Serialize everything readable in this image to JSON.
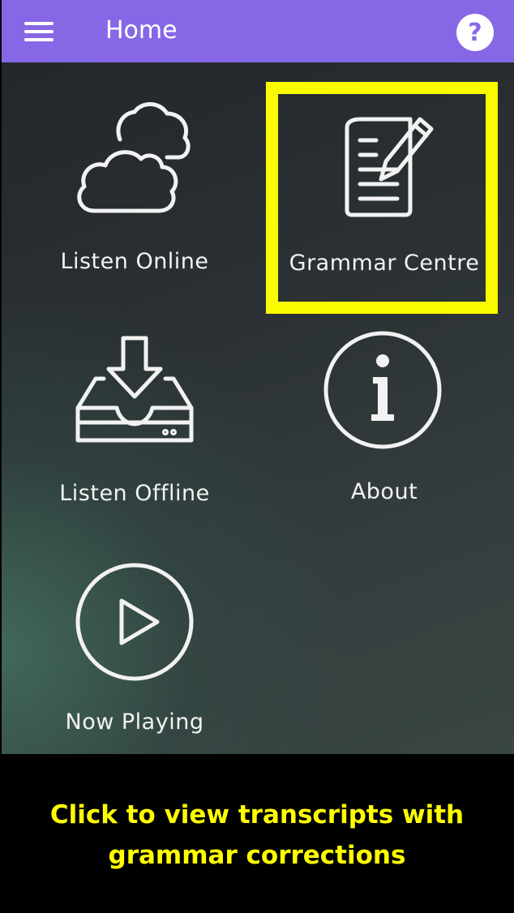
{
  "colors": {
    "appbar": "#8668e6",
    "highlight": "#fbfb00",
    "caption_text": "#ffff00",
    "background": "#000000"
  },
  "appbar": {
    "title": "Home",
    "menu_icon": "hamburger-menu-icon",
    "help_icon": "help-question-icon"
  },
  "tiles": [
    {
      "label": "Listen Online",
      "icon": "clouds-icon"
    },
    {
      "label": "Grammar Centre",
      "icon": "document-pencil-icon"
    },
    {
      "label": "Listen Offline",
      "icon": "download-tray-icon"
    },
    {
      "label": "About",
      "icon": "info-circle-icon"
    },
    {
      "label": "Now Playing",
      "icon": "play-circle-icon"
    }
  ],
  "caption": {
    "line1": "Click to view transcripts with",
    "line2": "grammar corrections"
  }
}
